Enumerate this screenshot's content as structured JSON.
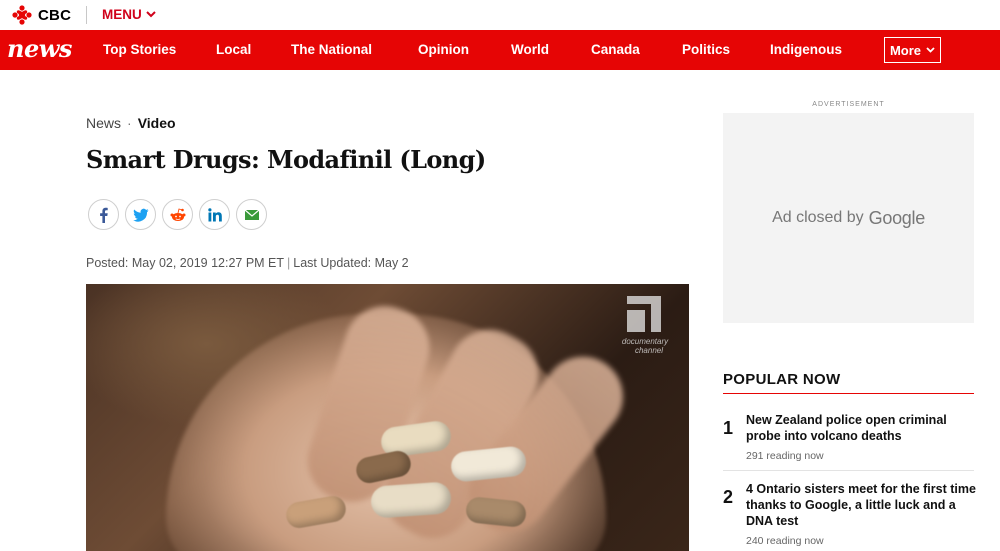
{
  "topbar": {
    "brand": "CBC",
    "menu_label": "MENU"
  },
  "navbar": {
    "logo": "news",
    "items": [
      {
        "label": "Top Stories"
      },
      {
        "label": "Local"
      },
      {
        "label": "The National"
      },
      {
        "label": "Opinion"
      },
      {
        "label": "World"
      },
      {
        "label": "Canada"
      },
      {
        "label": "Politics"
      },
      {
        "label": "Indigenous"
      }
    ],
    "more_label": "More"
  },
  "article": {
    "breadcrumb": {
      "section": "News",
      "separator": "·",
      "subsection": "Video"
    },
    "title": "Smart Drugs: Modafinil (Long)",
    "share_icons": [
      "facebook-icon",
      "twitter-icon",
      "reddit-icon",
      "linkedin-icon",
      "email-icon"
    ],
    "posted": "Posted: May 02, 2019 12:27 PM ET",
    "updated": "Last Updated: May 2",
    "video_watermark": "documentary channel"
  },
  "sidebar": {
    "ad_label": "ADVERTISEMENT",
    "ad_text": "Ad closed by",
    "ad_brand": "Google",
    "popular_title": "POPULAR NOW",
    "popular": [
      {
        "rank": "1",
        "headline": "New Zealand police open criminal probe into volcano deaths",
        "meta": "291 reading now"
      },
      {
        "rank": "2",
        "headline": "4 Ontario sisters meet for the first time thanks to Google, a little luck and a DNA test",
        "meta": "240 reading now"
      }
    ]
  },
  "colors": {
    "brand_red": "#e60505",
    "menu_red": "#d0021b"
  }
}
